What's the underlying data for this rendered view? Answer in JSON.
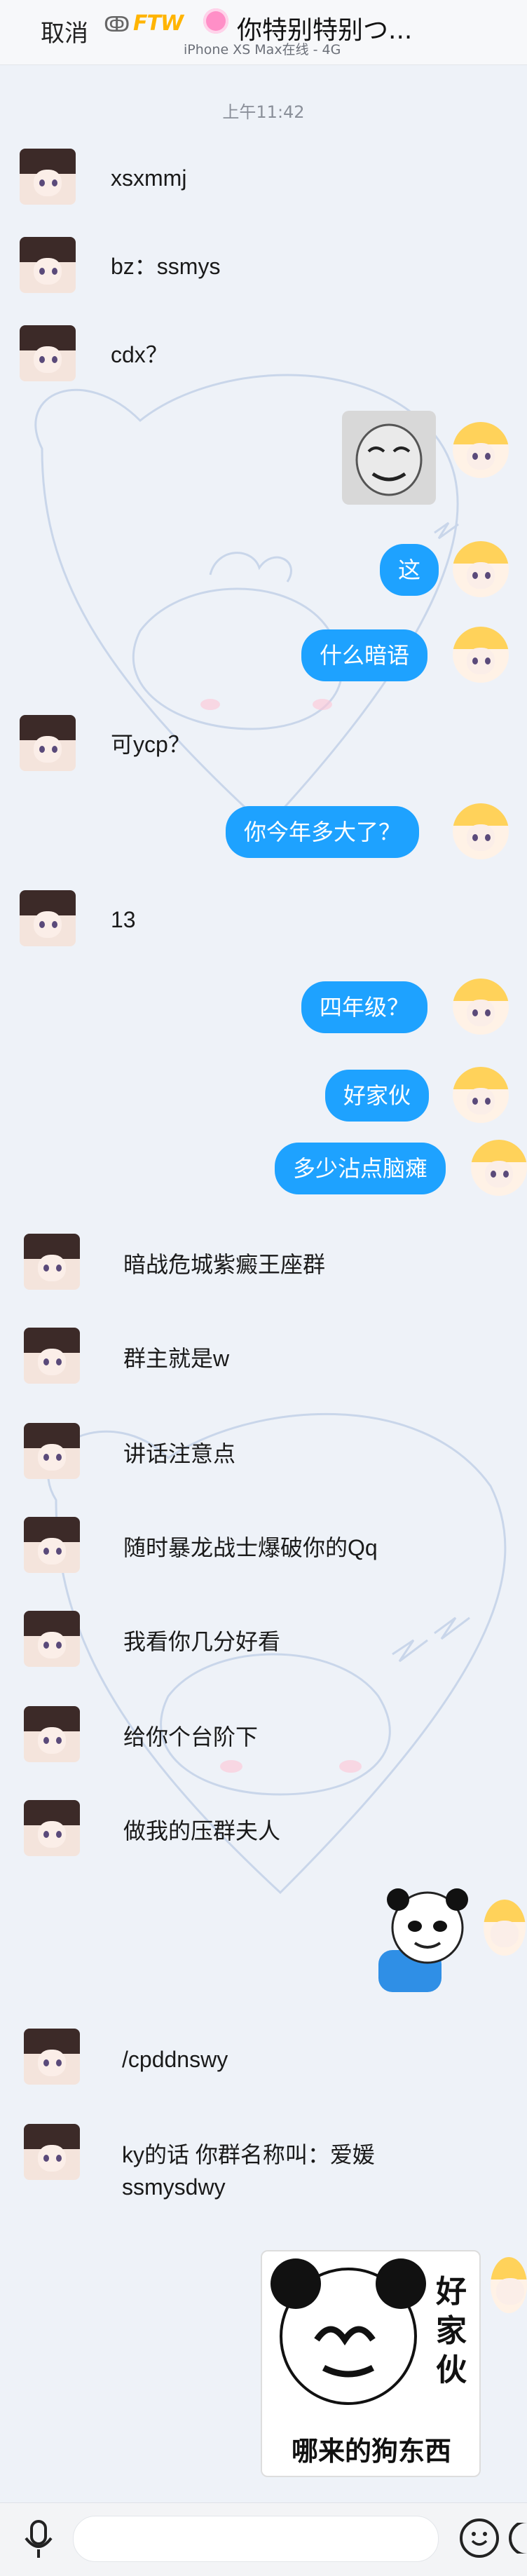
{
  "header": {
    "cancel_label": "取消",
    "ftw_text": "FTW",
    "title": "你特别特别つ...",
    "subtitle": "iPhone XS Max在线 - 4G"
  },
  "timestamp": "上午11:42",
  "messages": {
    "m1": "xsxmmj",
    "m2": "bz：ssmys",
    "m3": "cdx？",
    "m4": "这",
    "m5": "什么暗语",
    "m6": "可ycp？",
    "m7": "你今年多大了？",
    "m8": "13",
    "m9": "四年级？",
    "m10": "好家伙",
    "m11": "多少沾点脑瘫",
    "m12": "暗战危城紫癜王座群",
    "m13": "群主就是w",
    "m14": "讲话注意点",
    "m15": "随时暴龙战士爆破你的Qq",
    "m16": "我看你几分好看",
    "m17": "给你个台阶下",
    "m18": "做我的压群夫人",
    "m19": "/cpddnswy",
    "m20a": "ky的话 你群名称叫：爱媛",
    "m20b": "ssmysdwy"
  },
  "sticker_panda": {
    "side_text": "好家伙",
    "bottom_text": "哪来的狗东西"
  },
  "colors": {
    "bubble_blue": "#1ea2ff",
    "background": "#eef2f8"
  },
  "icons": [
    "ear-icon",
    "mic-icon",
    "emoji-icon",
    "plus-icon"
  ]
}
